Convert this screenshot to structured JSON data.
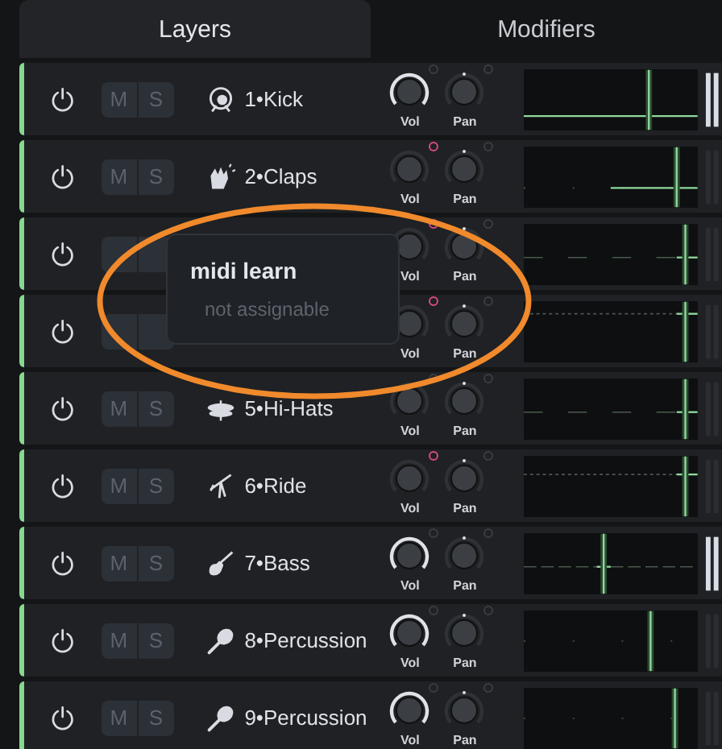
{
  "tabs": [
    {
      "label": "Layers",
      "selected": true
    },
    {
      "label": "Modifiers",
      "selected": false
    }
  ],
  "layers": [
    {
      "name": "1•Kick",
      "kind": "kick",
      "enabled": true,
      "mute": "M",
      "solo": "S",
      "vol_label": "Vol",
      "pan_label": "Pan",
      "vol_active": true,
      "midi_mapped": false,
      "meter_active": true
    },
    {
      "name": "2•Claps",
      "kind": "claps",
      "enabled": true,
      "mute": "M",
      "solo": "S",
      "vol_label": "Vol",
      "pan_label": "Pan",
      "vol_active": false,
      "midi_mapped": true,
      "meter_active": false
    },
    {
      "enabled": true,
      "vol_label": "Vol",
      "pan_label": "Pan",
      "vol_active": false,
      "midi_mapped": true,
      "meter_active": false
    },
    {
      "enabled": true,
      "vol_label": "Vol",
      "pan_label": "Pan",
      "vol_active": false,
      "midi_mapped": true,
      "meter_active": false
    },
    {
      "name": "5•Hi-Hats",
      "kind": "hihat",
      "enabled": true,
      "mute": "M",
      "solo": "S",
      "vol_label": "Vol",
      "pan_label": "Pan",
      "vol_active": false,
      "midi_mapped": false,
      "meter_active": false
    },
    {
      "name": "6•Ride",
      "kind": "ride",
      "enabled": true,
      "mute": "M",
      "solo": "S",
      "vol_label": "Vol",
      "pan_label": "Pan",
      "vol_active": false,
      "midi_mapped": true,
      "meter_active": false
    },
    {
      "name": "7•Bass",
      "kind": "bass",
      "enabled": true,
      "mute": "M",
      "solo": "S",
      "vol_label": "Vol",
      "pan_label": "Pan",
      "vol_active": true,
      "midi_mapped": false,
      "meter_active": true
    },
    {
      "name": "8•Percussion",
      "kind": "maraca",
      "enabled": true,
      "mute": "M",
      "solo": "S",
      "vol_label": "Vol",
      "pan_label": "Pan",
      "vol_active": true,
      "midi_mapped": false,
      "meter_active": false
    },
    {
      "name": "9•Percussion",
      "kind": "maraca",
      "enabled": true,
      "mute": "M",
      "solo": "S",
      "vol_label": "Vol",
      "pan_label": "Pan",
      "vol_active": true,
      "midi_mapped": false,
      "meter_active": false
    }
  ],
  "popup": {
    "title": "midi learn",
    "message": "not assignable"
  }
}
